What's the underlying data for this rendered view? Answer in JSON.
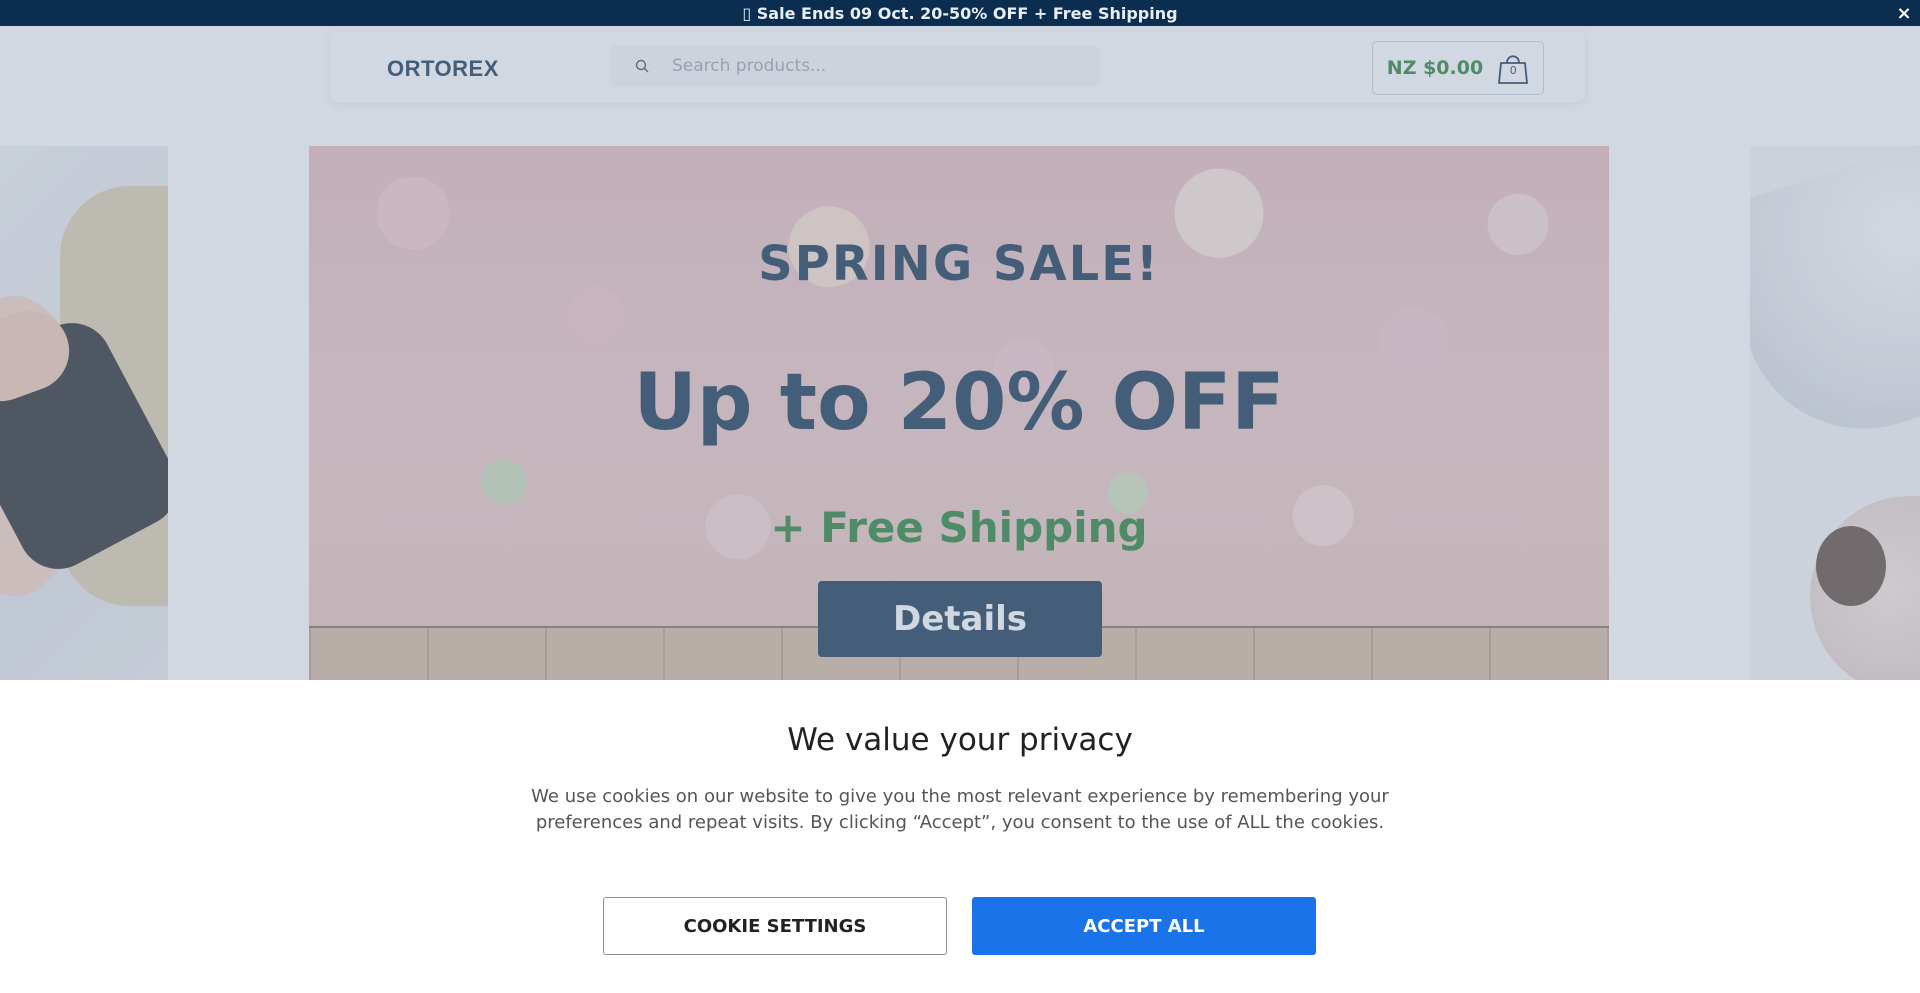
{
  "announcement": {
    "text": "▯ Sale Ends 09 Oct. 20-50% OFF + Free Shipping",
    "close_label": "×"
  },
  "header": {
    "logo": "ORTOREX",
    "search_placeholder": "Search products...",
    "cart_amount": "NZ $0.00",
    "cart_count": "0"
  },
  "hero": {
    "heading": "SPRING SALE!",
    "offer": "Up to 20% OFF",
    "shipping": "+ Free Shipping",
    "button_label": "Details"
  },
  "cookie_banner": {
    "title": "We value your privacy",
    "body": "We use cookies on our website to give you the most relevant experience by remembering your preferences and repeat visits. By clicking “Accept”, you consent to the use of ALL the cookies.",
    "settings_label": "COOKIE SETTINGS",
    "accept_label": "ACCEPT ALL"
  },
  "colors": {
    "navy": "#0b2d4f",
    "green": "#1c7a2e",
    "accept_blue": "#1a73e8"
  }
}
